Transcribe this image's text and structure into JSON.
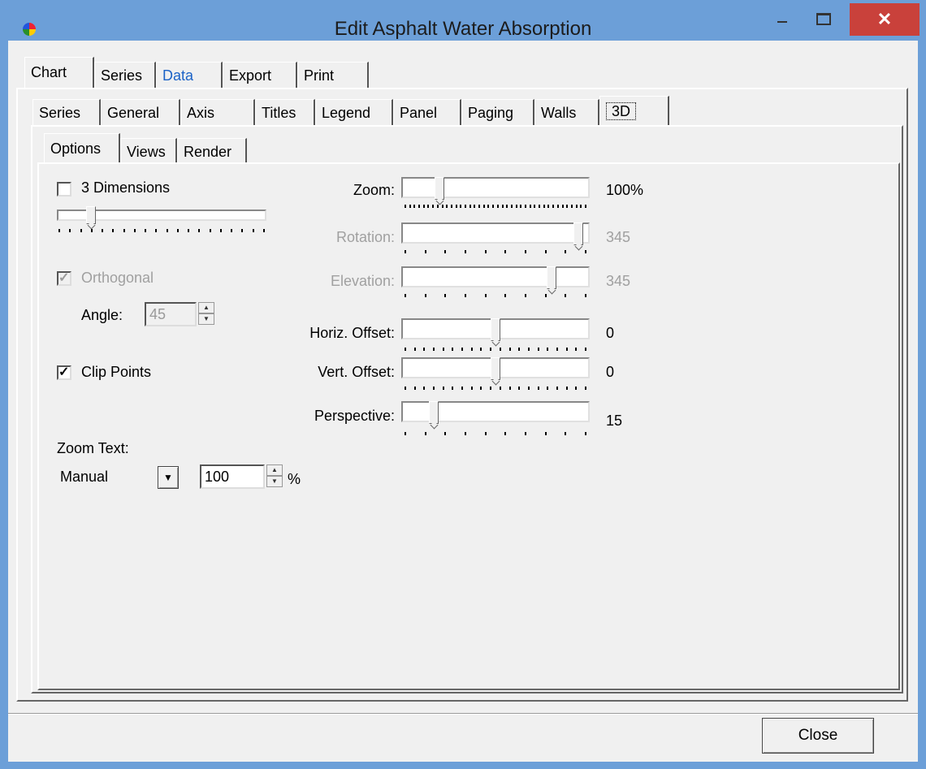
{
  "window": {
    "title": "Edit Asphalt Water Absorption",
    "close_glyph": "✕"
  },
  "top_tabs": [
    "Chart",
    "Series",
    "Data",
    "Export",
    "Print"
  ],
  "chart_tabs": [
    "Series",
    "General",
    "Axis",
    "Titles",
    "Legend",
    "Panel",
    "Paging",
    "Walls",
    "3D"
  ],
  "sub_tabs": [
    "Options",
    "Views",
    "Render"
  ],
  "options": {
    "three_d": {
      "label": "3 Dimensions",
      "checked": false
    },
    "orthogonal": {
      "label": "Orthogonal",
      "checked": true,
      "enabled": false
    },
    "angle": {
      "label": "Angle:",
      "value": "45"
    },
    "clip_points": {
      "label": "Clip Points",
      "checked": true
    },
    "zoom_text": {
      "label": "Zoom Text:",
      "mode": "Manual",
      "value": "100",
      "unit": "%"
    }
  },
  "sliders": {
    "zoom": {
      "label": "Zoom:",
      "value": "100%",
      "position": 0.18
    },
    "rotation": {
      "label": "Rotation:",
      "value": "345",
      "position": 0.97
    },
    "elevation": {
      "label": "Elevation:",
      "value": "345",
      "position": 0.82
    },
    "horiz_offset": {
      "label": "Horiz. Offset:",
      "value": "0",
      "position": 0.5
    },
    "vert_offset": {
      "label": "Vert. Offset:",
      "value": "0",
      "position": 0.5
    },
    "perspective": {
      "label": "Perspective:",
      "value": "15",
      "position": 0.15
    },
    "three_d_percent": {
      "position": 0.15
    }
  },
  "footer": {
    "close_label": "Close"
  },
  "colors": {
    "titlebar": "#6c9fd8",
    "close_button": "#c9413b",
    "link_tab": "#1c63c7"
  },
  "icons": {
    "app": "chart-pie-icon",
    "minimize": "minimize-icon",
    "maximize": "maximize-icon",
    "close": "close-icon"
  }
}
